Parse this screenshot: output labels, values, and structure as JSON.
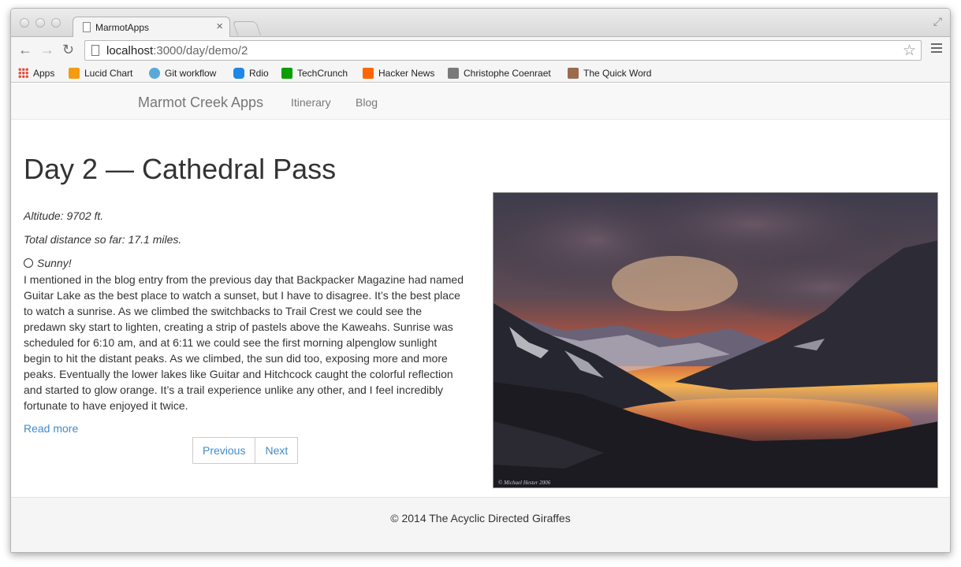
{
  "browser": {
    "tab_title": "MarmotApps",
    "url_host": "localhost",
    "url_path": ":3000/day/demo/2",
    "bookmarks": [
      {
        "label": "Apps",
        "icon": "apps-grid-icon",
        "color": "#e74c3c"
      },
      {
        "label": "Lucid Chart",
        "icon": "lucidchart-icon",
        "color": "#f39c12"
      },
      {
        "label": "Git workflow",
        "icon": "git-workflow-icon",
        "color": "#5aa8d8"
      },
      {
        "label": "Rdio",
        "icon": "rdio-icon",
        "color": "#1e88e5"
      },
      {
        "label": "TechCrunch",
        "icon": "techcrunch-icon",
        "color": "#0a9e01"
      },
      {
        "label": "Hacker News",
        "icon": "hacker-news-icon",
        "color": "#ff6600"
      },
      {
        "label": "Christophe Coenraet",
        "icon": "avatar-icon",
        "color": "#7a7a7a"
      },
      {
        "label": "The Quick Word",
        "icon": "quick-word-icon",
        "color": "#9b6b4e"
      }
    ]
  },
  "navbar": {
    "brand": "Marmot Creek Apps",
    "links": [
      "Itinerary",
      "Blog"
    ]
  },
  "day": {
    "title": "Day 2 — Cathedral Pass",
    "altitude": "Altitude: 9702 ft.",
    "distance": "Total distance so far: 17.1 miles.",
    "weather": "Sunny!",
    "weather_icon": "sun-icon",
    "body": "I mentioned in the blog entry from the previous day that Backpacker Magazine had named Guitar Lake as the best place to watch a sunset, but I have to disagree. It’s the best place to watch a sunrise. As we climbed the switchbacks to Trail Crest we could see the predawn sky start to lighten, creating a strip of pastels above the Kaweahs. Sunrise was scheduled for 6:10 am, and at 6:11 we could see the first morning alpenglow sunlight begin to hit the distant peaks. As we climbed, the sun did too, exposing more and more peaks. Eventually the lower lakes like Guitar and Hitchcock caught the colorful reflection and started to glow orange. It’s a trail experience unlike any other, and I feel incredibly fortunate to have enjoyed it twice.",
    "read_more": "Read more",
    "pager": {
      "previous": "Previous",
      "next": "Next"
    },
    "photo_credit": "© Michael Hester 2006"
  },
  "footer": {
    "text": "© 2014 The Acyclic Directed Giraffes"
  }
}
